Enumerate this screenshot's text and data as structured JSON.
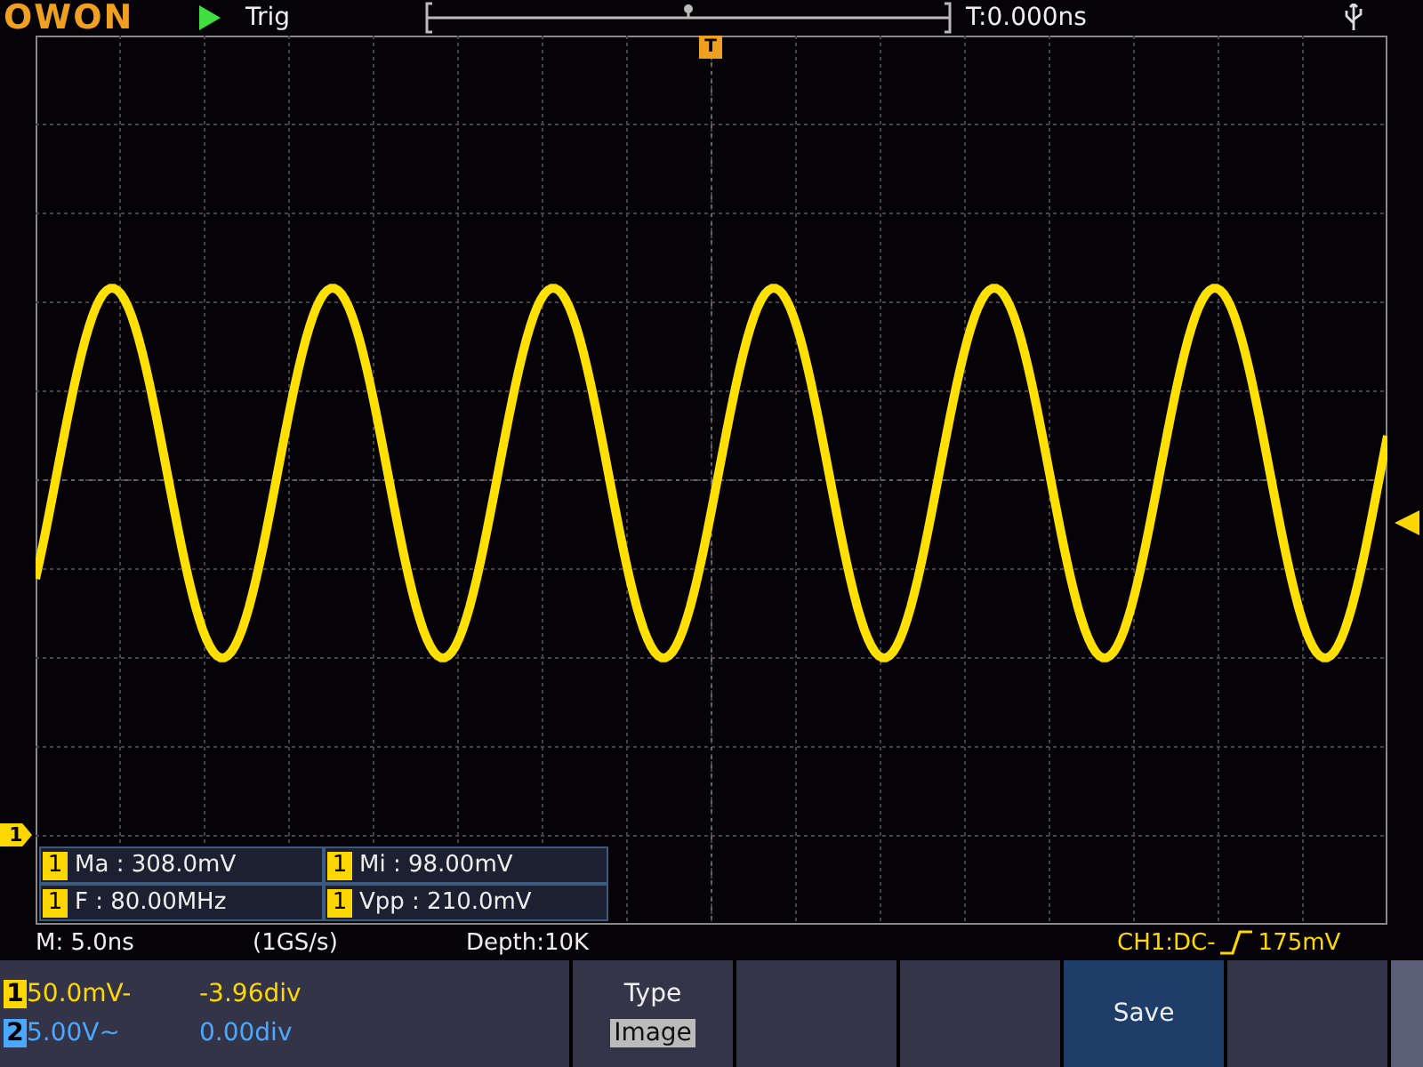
{
  "top_bar": {
    "logo": "OWON",
    "running": true,
    "trigger_mode": "Trig",
    "time_offset": "T:0.000ns"
  },
  "markers": {
    "trigger_position": "T",
    "channel_marker": "1"
  },
  "measurements": [
    {
      "channel": "1",
      "text": "Ma : 308.0mV"
    },
    {
      "channel": "1",
      "text": "Mi : 98.00mV"
    },
    {
      "channel": "1",
      "text": "F : 80.00MHz"
    },
    {
      "channel": "1",
      "text": "Vpp : 210.0mV"
    }
  ],
  "status": {
    "timebase": "M: 5.0ns",
    "sample_rate": "(1GS/s)",
    "depth": "Depth:10K",
    "trigger_source": "CH1:DC-",
    "trigger_level": "175mV"
  },
  "channels": [
    {
      "badge": "1",
      "scale": "50.0mV-",
      "offset": "-3.96div",
      "color": "#ffd700"
    },
    {
      "badge": "2",
      "scale": "5.00V~",
      "offset": "0.00div",
      "color": "#4aa8ff"
    }
  ],
  "menu": [
    {
      "kind": "option",
      "label": "Type",
      "value": "Image",
      "selected": false
    },
    {
      "kind": "empty",
      "selected": false
    },
    {
      "kind": "empty",
      "selected": false
    },
    {
      "kind": "action",
      "label": "Save",
      "selected": true
    },
    {
      "kind": "empty",
      "selected": false
    }
  ]
}
